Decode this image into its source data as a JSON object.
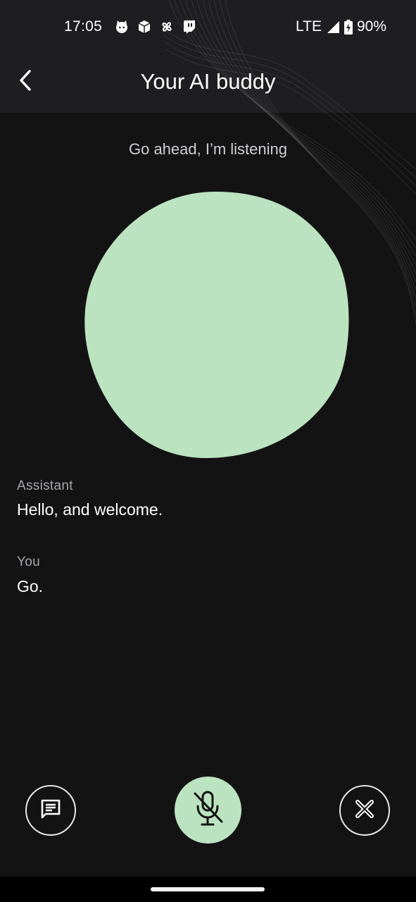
{
  "status_bar": {
    "time": "17:05",
    "notification_icons": [
      "cat-icon",
      "package-icon",
      "pinwheel-icon",
      "twitch-icon"
    ],
    "network": "LTE",
    "battery": "90%"
  },
  "header": {
    "title": "Your AI buddy",
    "back_icon": "chevron-left-icon"
  },
  "listening": {
    "status_text": "Go ahead, I’m listening",
    "orb_color": "#bce3c0"
  },
  "transcript": [
    {
      "role": "Assistant",
      "text": "Hello, and welcome."
    },
    {
      "role": "You",
      "text": "Go."
    }
  ],
  "controls": {
    "chat_icon": "chat-icon",
    "mic_icon": "mic-off-icon",
    "mic_state": "muted",
    "close_icon": "close-icon"
  },
  "colors": {
    "background": "#131314",
    "header_background": "#1e1e21",
    "accent": "#bce3c0",
    "text_primary": "#ffffff",
    "text_secondary": "#a8a8ad"
  }
}
